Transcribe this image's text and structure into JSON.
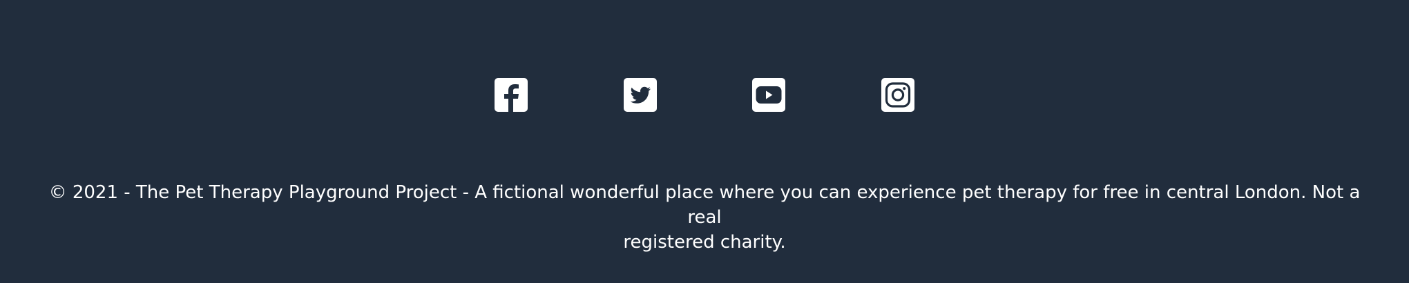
{
  "footer": {
    "background_color": "#212d3d",
    "icon_color": "#ffffff",
    "social_links": [
      {
        "icon": "facebook-icon"
      },
      {
        "icon": "twitter-icon"
      },
      {
        "icon": "youtube-icon"
      },
      {
        "icon": "instagram-icon"
      }
    ],
    "copyright_line1": "© 2021 - The Pet Therapy Playground Project - A fictional wonderful place where you can experience pet therapy for free in central London. Not a real",
    "copyright_line2": "registered charity."
  }
}
